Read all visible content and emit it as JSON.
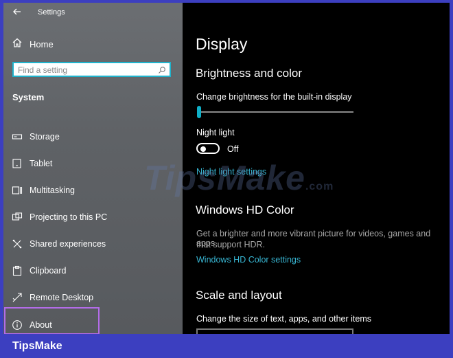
{
  "app": {
    "title": "Settings"
  },
  "sidebar": {
    "home_label": "Home",
    "search_placeholder": "Find a setting",
    "section_label": "System",
    "items": [
      {
        "label": "Storage",
        "icon": "storage-icon"
      },
      {
        "label": "Tablet",
        "icon": "tablet-icon"
      },
      {
        "label": "Multitasking",
        "icon": "multitasking-icon"
      },
      {
        "label": "Projecting to this PC",
        "icon": "projecting-icon"
      },
      {
        "label": "Shared experiences",
        "icon": "shared-experiences-icon"
      },
      {
        "label": "Clipboard",
        "icon": "clipboard-icon"
      },
      {
        "label": "Remote Desktop",
        "icon": "remote-desktop-icon"
      },
      {
        "label": "About",
        "icon": "info-icon"
      }
    ]
  },
  "main": {
    "title": "Display",
    "brightness": {
      "heading": "Brightness and color",
      "slider_label": "Change brightness for the built-in display",
      "slider_value": 0.0
    },
    "night_light": {
      "label": "Night light",
      "state": "Off",
      "settings_link": "Night light settings"
    },
    "hd_color": {
      "heading": "Windows HD Color",
      "description_line1": "Get a brighter and more vibrant picture for videos, games and apps",
      "description_line2": "that support HDR.",
      "settings_link": "Windows HD Color settings"
    },
    "scale": {
      "heading": "Scale and layout",
      "size_label": "Change the size of text, apps, and other items"
    }
  },
  "watermark": {
    "text": "TipsMake",
    "suffix": ".com"
  },
  "footer": {
    "brand": "TipsMake"
  },
  "colors": {
    "accent": "#38b7d4",
    "highlight_border": "#b36ce8",
    "frame": "#3c3fc0"
  }
}
